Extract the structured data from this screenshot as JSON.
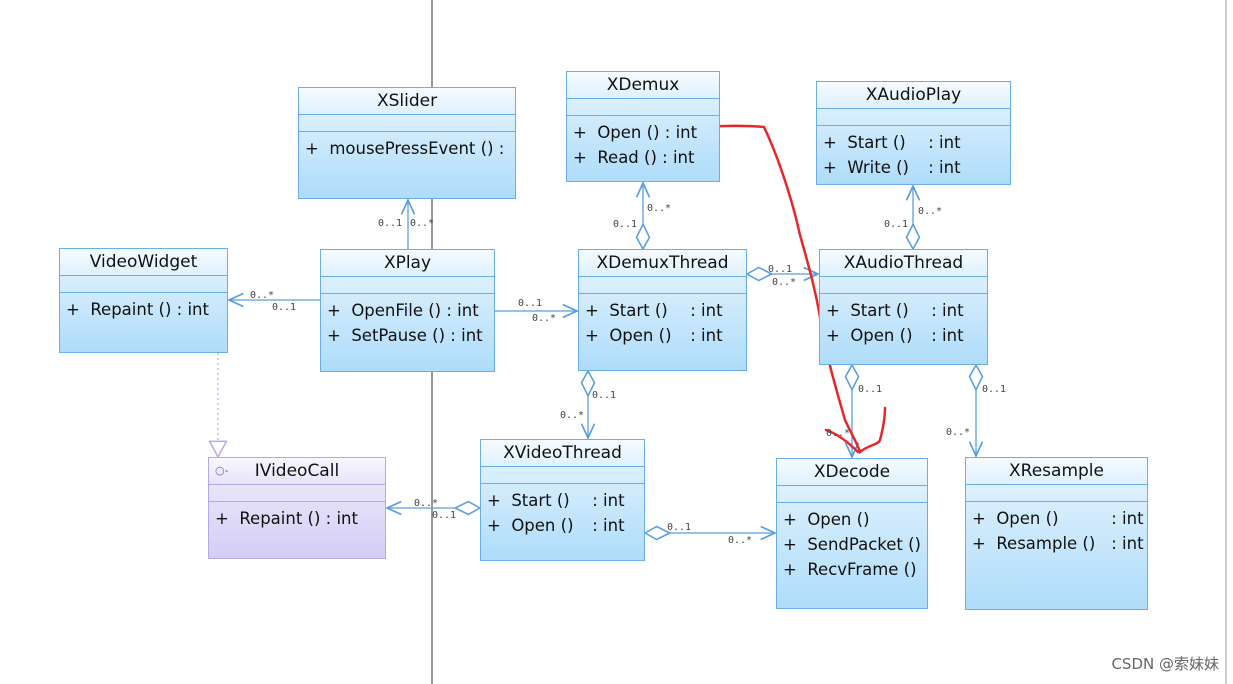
{
  "classes": [
    {
      "name": "XSlider",
      "methods": [
        {
          "vis": "+",
          "name": "mousePressEvent ()",
          "type": ":"
        }
      ]
    },
    {
      "name": "XDemux",
      "methods": [
        {
          "vis": "+",
          "name": "Open ()",
          "type": ": int"
        },
        {
          "vis": "+",
          "name": "Read ()",
          "type": ": int"
        }
      ]
    },
    {
      "name": "XAudioPlay",
      "methods": [
        {
          "vis": "+",
          "name": "Start ()",
          "type": ": int"
        },
        {
          "vis": "+",
          "name": "Write ()",
          "type": ": int"
        }
      ]
    },
    {
      "name": "VideoWidget",
      "methods": [
        {
          "vis": "+",
          "name": "Repaint ()",
          "type": ": int"
        }
      ]
    },
    {
      "name": "XPlay",
      "methods": [
        {
          "vis": "+",
          "name": "OpenFile ()",
          "type": ": int"
        },
        {
          "vis": "+",
          "name": "SetPause ()",
          "type": ": int"
        }
      ]
    },
    {
      "name": "XDemuxThread",
      "methods": [
        {
          "vis": "+",
          "name": "Start ()",
          "type": ": int"
        },
        {
          "vis": "+",
          "name": "Open ()",
          "type": ": int"
        }
      ]
    },
    {
      "name": "XAudioThread",
      "methods": [
        {
          "vis": "+",
          "name": "Start ()",
          "type": ": int"
        },
        {
          "vis": "+",
          "name": "Open ()",
          "type": ": int"
        }
      ]
    },
    {
      "name": "IVideoCall",
      "stereotype": "interface",
      "icon": "interface-icon",
      "methods": [
        {
          "vis": "+",
          "name": "Repaint ()",
          "type": ": int"
        }
      ]
    },
    {
      "name": "XVideoThread",
      "methods": [
        {
          "vis": "+",
          "name": "Start ()",
          "type": ": int"
        },
        {
          "vis": "+",
          "name": "Open ()",
          "type": ": int"
        }
      ]
    },
    {
      "name": "XDecode",
      "methods": [
        {
          "vis": "+",
          "name": "Open ()",
          "type": ""
        },
        {
          "vis": "+",
          "name": "SendPacket ()",
          "type": ""
        },
        {
          "vis": "+",
          "name": "RecvFrame ()",
          "type": ""
        }
      ]
    },
    {
      "name": "XResample",
      "methods": [
        {
          "vis": "+",
          "name": "Open ()",
          "type": ": int"
        },
        {
          "vis": "+",
          "name": "Resample ()",
          "type": ": int"
        }
      ]
    }
  ],
  "multiplicities": [
    "0..1",
    "0..*",
    "0..*",
    "0..1",
    "0..1",
    "0..*",
    "0..*",
    "0..1",
    "0..1",
    "0..*",
    "0..*",
    "0..1",
    "0..1",
    "0..*",
    "0..1",
    "0..*",
    "0..1",
    "0..*",
    "0..*",
    "0..1",
    "0..1",
    "0..*"
  ],
  "colors": {
    "class_border": "#6aaee8",
    "interface_border": "#b3a8e8",
    "connector": "#5a9de0",
    "annotation": "#e8262a"
  },
  "watermark": "CSDN @索妹妹"
}
